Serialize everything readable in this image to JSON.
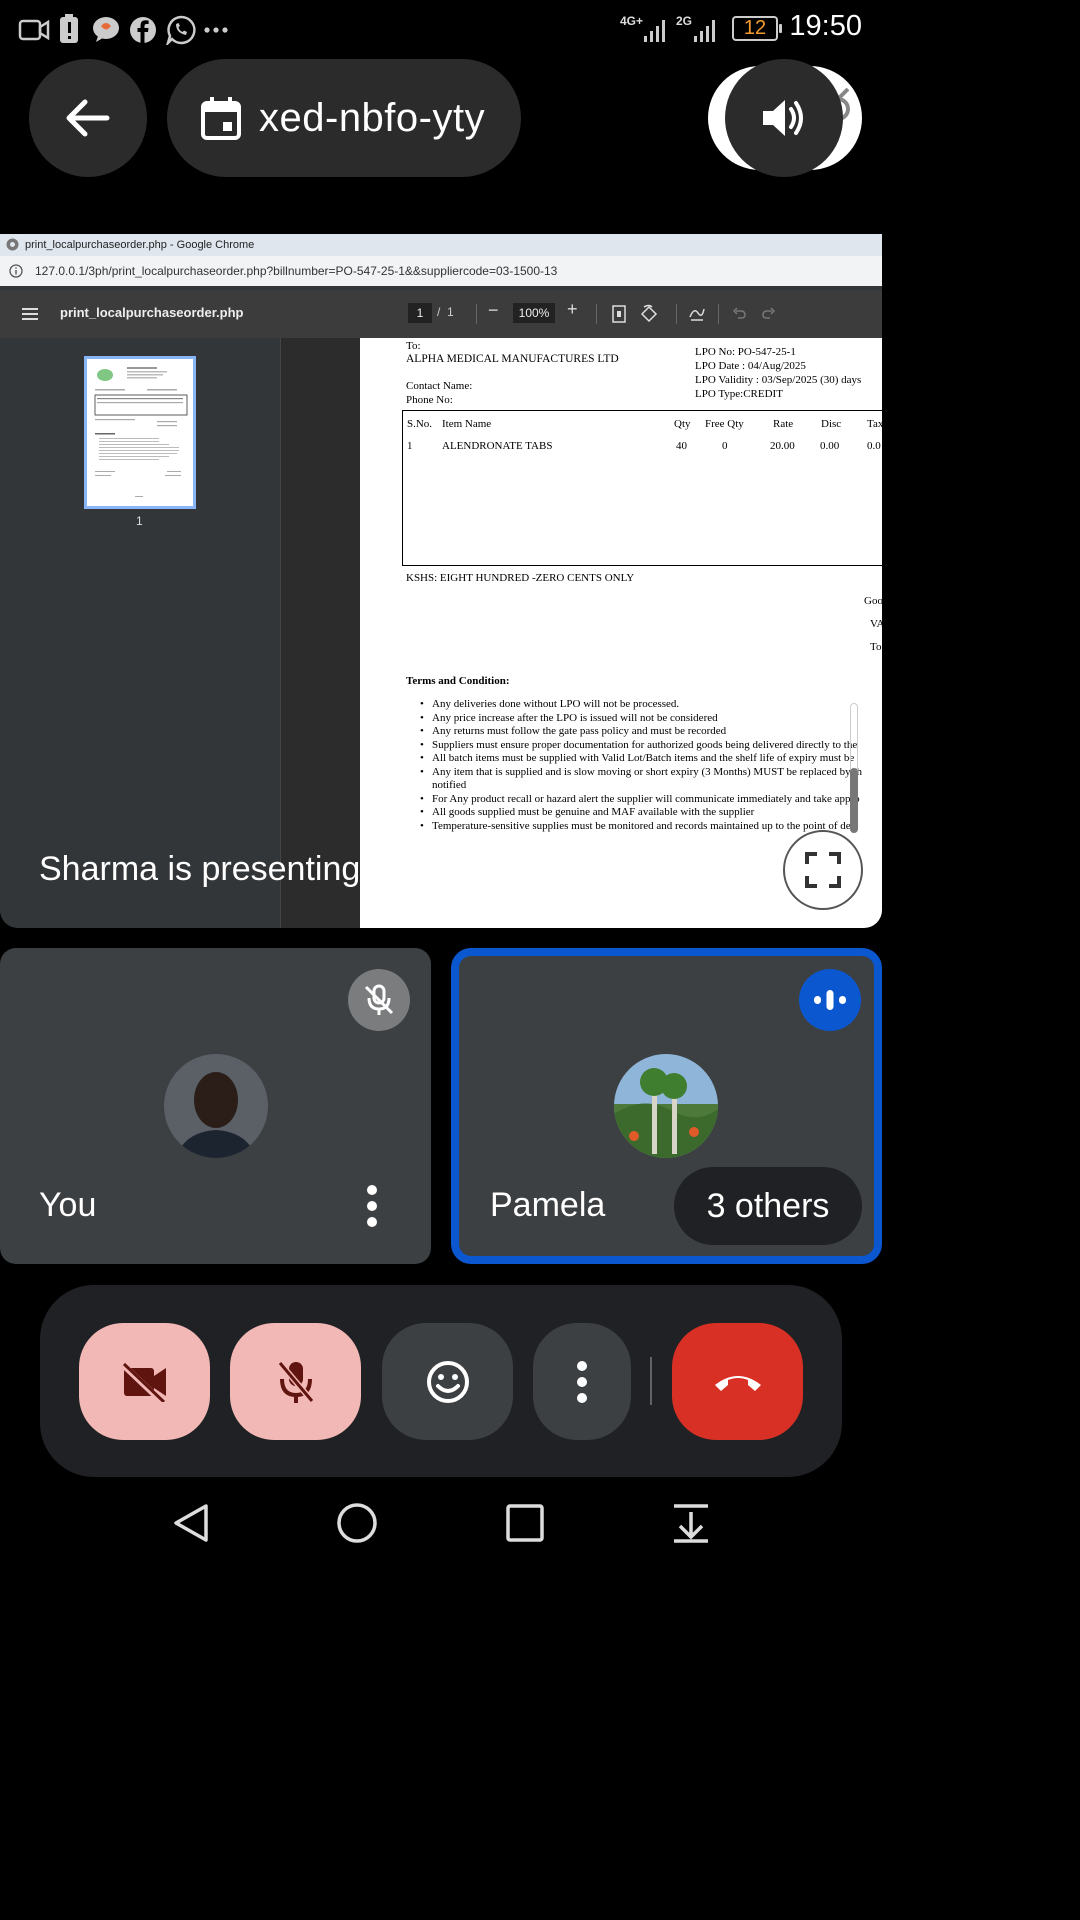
{
  "status_bar": {
    "time": "19:50",
    "battery": "12",
    "net1": "4G+",
    "net2": "2G",
    "icons": [
      "video-camera-icon",
      "battery-alert-icon",
      "messenger-icon",
      "facebook-icon",
      "whatsapp-icon",
      "more-icon"
    ]
  },
  "meeting": {
    "code": "xed-nbfo-yty",
    "presenting_label": "Sharma is presenting"
  },
  "chrome": {
    "window_title": "print_localpurchaseorder.php - Google Chrome",
    "url": "127.0.0.1/3ph/print_localpurchaseorder.php?billnumber=PO-547-25-1&&suppliercode=03-1500-13"
  },
  "pdf_viewer": {
    "filename": "print_localpurchaseorder.php",
    "page_current": "1",
    "page_sep": "/",
    "page_total": "1",
    "zoom": "100%",
    "thumbnail_label": "1"
  },
  "document": {
    "to_label": "To:",
    "supplier": "ALPHA MEDICAL MANUFACTURES LTD",
    "contact_name": "Contact Name:",
    "phone_no": "Phone No:",
    "lpo_no": "LPO No: PO-547-25-1",
    "lpo_date": "LPO Date : 04/Aug/2025",
    "lpo_validity": "LPO Validity : 03/Sep/2025 (30) days",
    "lpo_type": "LPO Type:CREDIT",
    "table_headers": [
      "S.No.",
      "Item Name",
      "Qty",
      "Free Qty",
      "Rate",
      "Disc",
      "Tax"
    ],
    "table_rows": [
      [
        "1",
        "ALENDRONATE TABS",
        "40",
        "0",
        "20.00",
        "0.00",
        "0.0"
      ]
    ],
    "amount_words": "KSHS: EIGHT HUNDRED -ZERO CENTS ONLY",
    "right_totals": [
      "Goo",
      "VA",
      "To"
    ],
    "terms_title": "Terms and Condition:",
    "terms": [
      "Any deliveries done without LPO will not be processed.",
      "Any price increase after the LPO is issued will not be considered",
      "Any returns must follow the gate pass policy and must be recorded",
      "Suppliers must ensure proper documentation for authorized goods being delivered directly to the",
      "All batch items must be supplied with Valid Lot/Batch items and the shelf life of expiry must be",
      "Any item that is supplied and is slow moving or short expiry (3 Months) MUST be replaced by th",
      "notified",
      "For Any product recall or hazard alert the supplier will communicate immediately and take appro",
      "All goods supplied must be genuine and MAF available with the supplier",
      "Temperature-sensitive supplies must be monitored and records maintained up to the point of deli"
    ]
  },
  "participants": {
    "self_name": "You",
    "other_name": "Pamela",
    "others_count": "3 others"
  },
  "colors": {
    "tile_bg": "#3c4043",
    "speaking_border": "#0b57d0",
    "hangup_red": "#d93025",
    "muted_pink": "#f2b8b5"
  }
}
